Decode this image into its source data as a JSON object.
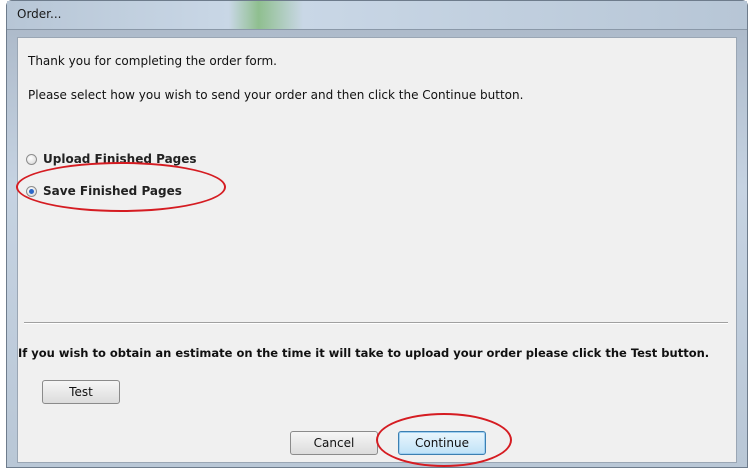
{
  "window": {
    "title": "Order..."
  },
  "text": {
    "thanks": "Thank you for completing the order form.",
    "instruction": "Please select how you wish to send your order and then click the Continue button.",
    "estimate": "If you wish to obtain an estimate on the time it will take to upload your order please click the Test button."
  },
  "options": [
    {
      "label": "Upload Finished Pages",
      "checked": false
    },
    {
      "label": "Save Finished Pages",
      "checked": true
    }
  ],
  "buttons": {
    "test": "Test",
    "cancel": "Cancel",
    "continue": "Continue"
  },
  "colors": {
    "annotation": "#d51c22",
    "radio_selected": "#2b67c9"
  }
}
